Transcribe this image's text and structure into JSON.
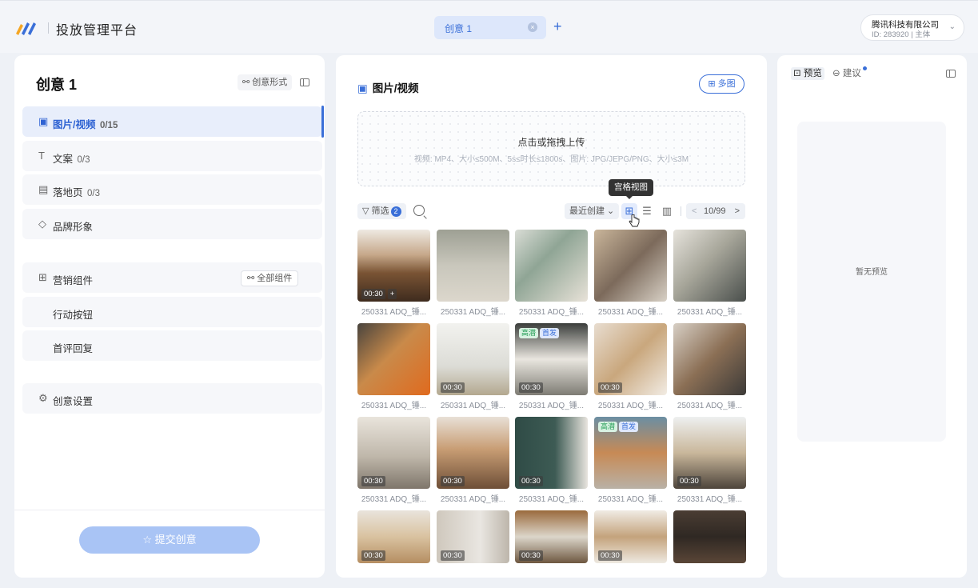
{
  "header": {
    "app_title": "投放管理平台",
    "tab_label": "创意 1",
    "tab_close": "×",
    "tab_add": "+",
    "account_name": "腾讯科技有限公司",
    "account_id": "ID: 283920 | 主体",
    "account_chevron": "⌄"
  },
  "left": {
    "title": "创意 1",
    "form_button": "⚯ 创意形式",
    "nav": [
      {
        "icon": "▣",
        "label": "图片/视频",
        "count": "0/15"
      },
      {
        "icon": "T",
        "label": "文案",
        "count": "0/3"
      },
      {
        "icon": "▤",
        "label": "落地页",
        "count": "0/3"
      },
      {
        "icon": "◇",
        "label": "品牌形象",
        "count": ""
      }
    ],
    "marketing": {
      "icon": "⊞",
      "label": "营销组件",
      "all_button": "⚯ 全部组件"
    },
    "sub_items": [
      "行动按钮",
      "首评回复"
    ],
    "settings": {
      "icon": "⚙",
      "label": "创意设置"
    },
    "submit": "☆ 提交创意"
  },
  "middle": {
    "title_icon": "▣",
    "title": "图片/视频",
    "multi_button": "⊞ 多图",
    "upload_title": "点击或拖拽上传",
    "upload_hint": "视频: MP4、大小≤500M、5s≤时长≤1800s、图片: JPG/JEPG/PNG、大小≤3M",
    "filter_label": "▽ 筛选",
    "filter_count": "2",
    "sort_label": "最近创建 ⌄",
    "view_grid": "⊞",
    "view_list": "☰",
    "view_cols": "▥",
    "pager_prev": "<",
    "pager_value": "10/99",
    "pager_next": ">",
    "tooltip": "宫格视图",
    "items": [
      {
        "caption": "250331 ADQ_锤...",
        "duration": "00:30",
        "plus": "+",
        "tags": []
      },
      {
        "caption": "250331 ADQ_锤...",
        "duration": "",
        "tags": []
      },
      {
        "caption": "250331 ADQ_锤...",
        "duration": "",
        "tags": []
      },
      {
        "caption": "250331 ADQ_锤...",
        "duration": "",
        "tags": []
      },
      {
        "caption": "250331 ADQ_锤...",
        "duration": "",
        "tags": []
      },
      {
        "caption": "250331 ADQ_锤...",
        "duration": "",
        "tags": []
      },
      {
        "caption": "250331 ADQ_锤...",
        "duration": "00:30",
        "tags": []
      },
      {
        "caption": "250331 ADQ_锤...",
        "duration": "00:30",
        "tags": [
          "高潜",
          "首发"
        ]
      },
      {
        "caption": "250331 ADQ_锤...",
        "duration": "00:30",
        "tags": []
      },
      {
        "caption": "250331 ADQ_锤...",
        "duration": "",
        "tags": []
      },
      {
        "caption": "250331 ADQ_锤...",
        "duration": "00:30",
        "tags": []
      },
      {
        "caption": "250331 ADQ_锤...",
        "duration": "00:30",
        "tags": []
      },
      {
        "caption": "250331 ADQ_锤...",
        "duration": "00:30",
        "tags": []
      },
      {
        "caption": "250331 ADQ_锤...",
        "duration": "",
        "tags": [
          "高潜",
          "首发"
        ]
      },
      {
        "caption": "250331 ADQ_锤...",
        "duration": "00:30",
        "tags": []
      },
      {
        "caption": "",
        "duration": "00:30",
        "tags": []
      },
      {
        "caption": "",
        "duration": "00:30",
        "tags": []
      },
      {
        "caption": "",
        "duration": "00:30",
        "tags": []
      },
      {
        "caption": "",
        "duration": "00:30",
        "tags": []
      },
      {
        "caption": "",
        "duration": "",
        "tags": []
      }
    ]
  },
  "right": {
    "preview_tab": "⊡ 预览",
    "suggest_tab": "⊖ 建议",
    "empty_text": "暂无预览"
  },
  "colors": {
    "accent": "#3a6fd8",
    "submit_disabled": "#a9c4f5",
    "tag_hot": "#1f9b52"
  }
}
